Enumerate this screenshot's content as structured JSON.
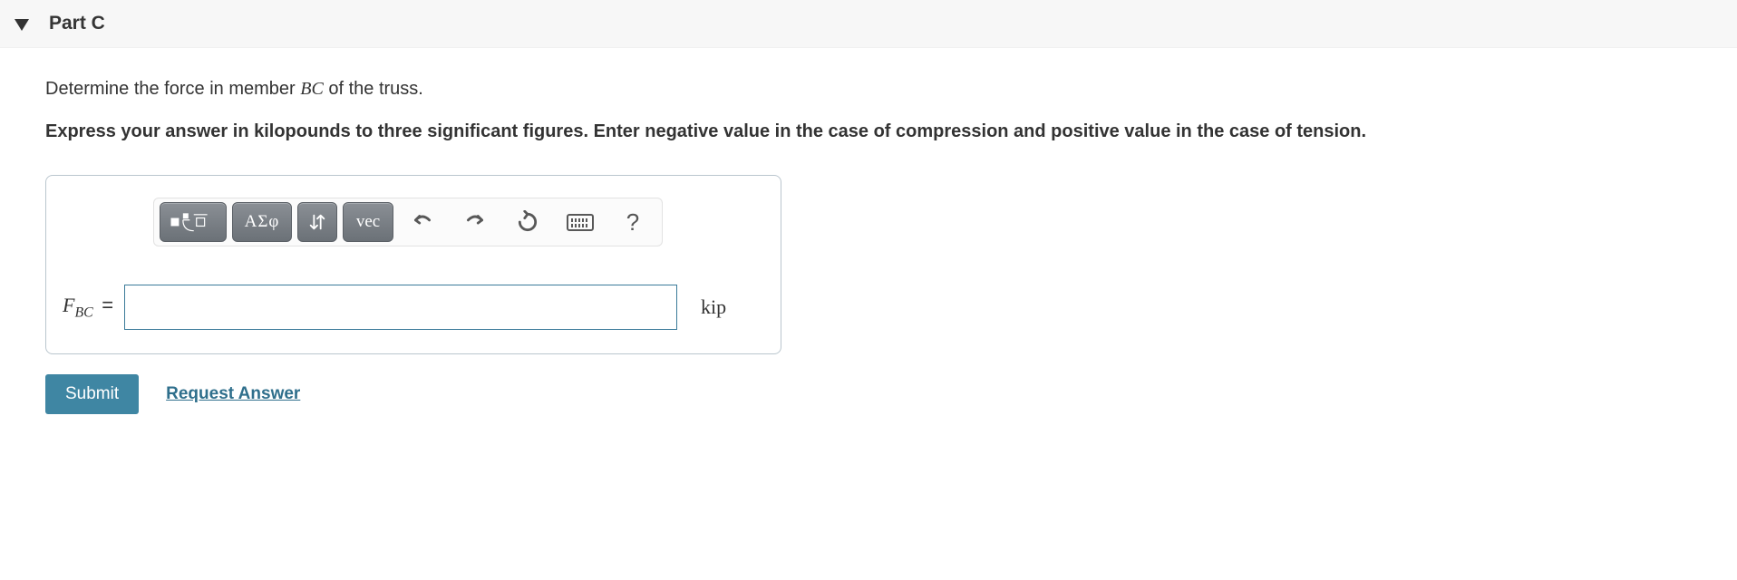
{
  "header": {
    "part_label": "Part C"
  },
  "instruction": {
    "prefix": "Determine the force in member ",
    "member": "BC",
    "suffix": " of the truss."
  },
  "bold_instruction": "Express your answer in kilopounds to three significant figures. Enter negative value in the case of compression and positive value in the case of tension.",
  "toolbar": {
    "greek_label": "ΑΣφ",
    "vec_label": "vec",
    "help_label": "?"
  },
  "answer": {
    "var_main": "F",
    "var_sub": "BC",
    "equals": "=",
    "value": "",
    "unit": "kip"
  },
  "actions": {
    "submit": "Submit",
    "request": "Request Answer"
  }
}
